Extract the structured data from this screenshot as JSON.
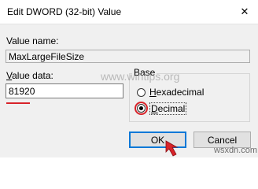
{
  "window": {
    "title": "Edit DWORD (32-bit) Value",
    "close_glyph": "✕"
  },
  "value_name": {
    "label": "Value name:",
    "value": "MaxLargeFileSize"
  },
  "value_data": {
    "label_first": "V",
    "label_rest": "alue data:",
    "value": "81920"
  },
  "base": {
    "label": "Base",
    "options": [
      {
        "accel": "H",
        "rest": "exadecimal",
        "selected": false
      },
      {
        "accel": "D",
        "rest": "ecimal",
        "selected": true
      }
    ]
  },
  "buttons": {
    "ok": "OK",
    "cancel": "Cancel"
  },
  "watermarks": {
    "center": "www.wintips.org",
    "corner": "wsxdn.com"
  },
  "colors": {
    "annotation_red": "#d8232a",
    "focus_blue": "#0078d7"
  },
  "icons": {
    "close": "close-icon",
    "pointer": "red-arrow-pointer-icon"
  }
}
